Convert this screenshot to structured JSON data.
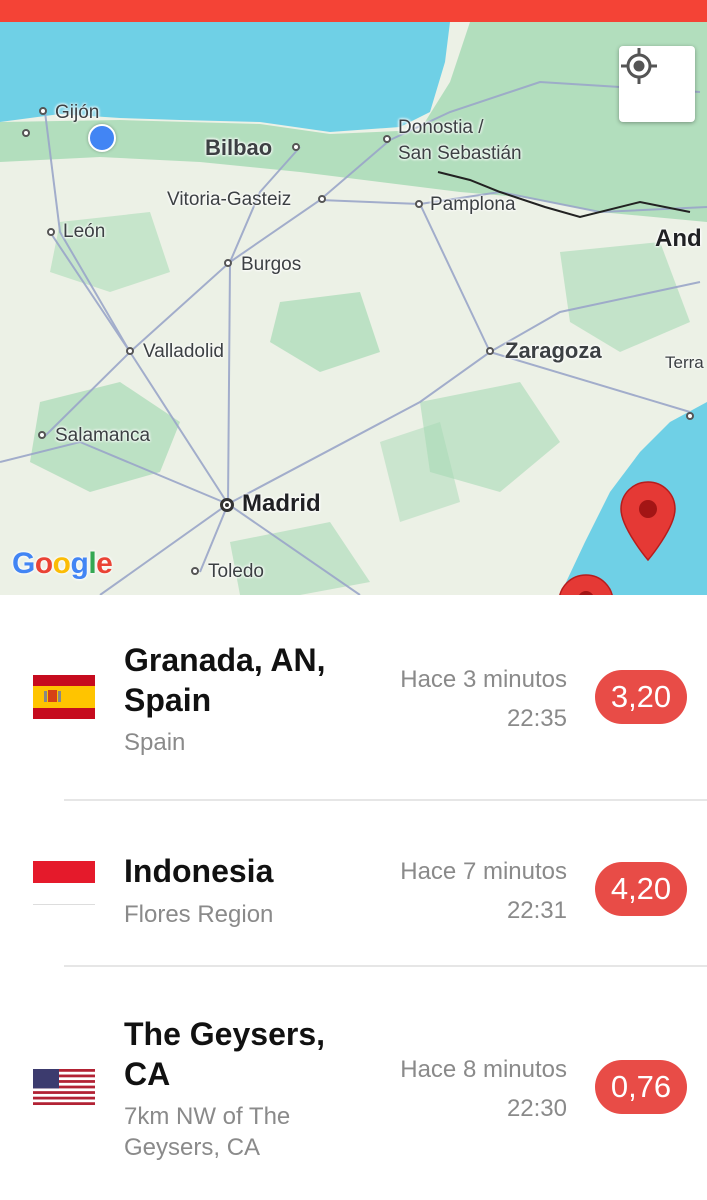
{
  "map": {
    "labels": {
      "gijon": "Gijón",
      "bilbao": "Bilbao",
      "donostia1": "Donostia /",
      "donostia2": "San Sebastián",
      "vitoria": "Vitoria-Gasteiz",
      "pamplona": "Pamplona",
      "andorra": "And",
      "leon": "León",
      "burgos": "Burgos",
      "valladolid": "Valladolid",
      "zaragoza": "Zaragoza",
      "terra": "Terra",
      "salamanca": "Salamanca",
      "madrid": "Madrid",
      "toledo": "Toledo"
    },
    "attribution": "Google",
    "locate_icon": "my-location-icon",
    "colors": {
      "sea": "#6fd0e6",
      "land": "#e9efe3",
      "green": "#a8dab5",
      "marker": "#e53935"
    }
  },
  "quakes": [
    {
      "title": "Granada, AN, Spain",
      "region": "Spain",
      "ago": "Hace 3 minutos",
      "time": "22:35",
      "magnitude": "3,20",
      "flag": "spain-flag-icon"
    },
    {
      "title": "Indonesia",
      "region": "Flores Region",
      "ago": "Hace 7 minutos",
      "time": "22:31",
      "magnitude": "4,20",
      "flag": "indonesia-flag-icon"
    },
    {
      "title": "The Geysers, CA",
      "region": "7km NW of The Geysers, CA",
      "ago": "Hace 8 minutos",
      "time": "22:30",
      "magnitude": "0,76",
      "flag": "usa-flag-icon"
    }
  ]
}
